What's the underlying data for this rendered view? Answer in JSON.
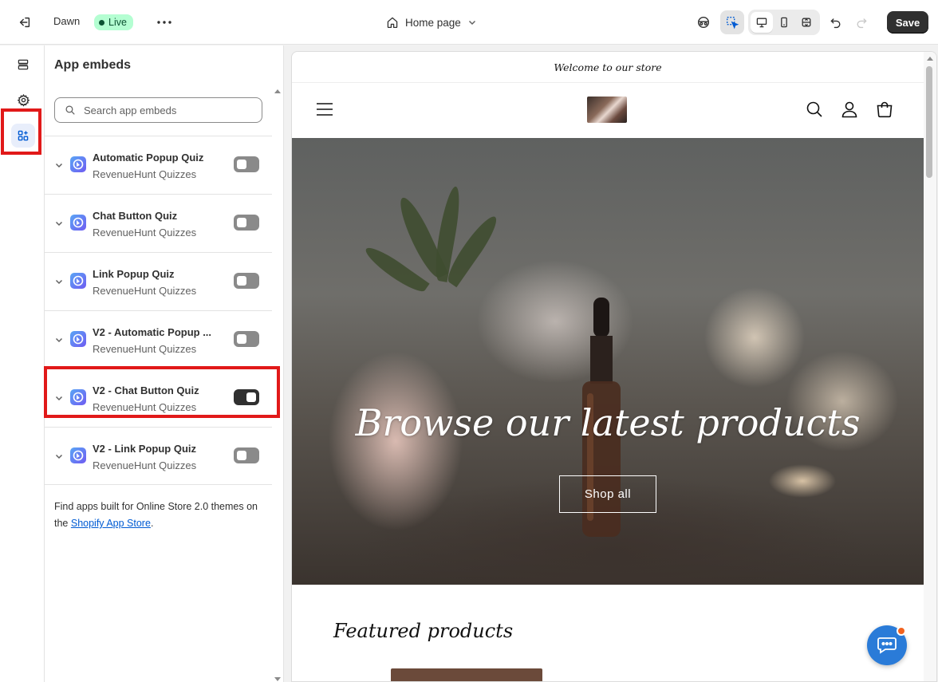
{
  "topbar": {
    "theme_name": "Dawn",
    "status_badge": "Live",
    "page_selector": "Home page",
    "save_label": "Save"
  },
  "panel": {
    "title": "App embeds",
    "search_placeholder": "Search app embeds",
    "items": [
      {
        "name": "Automatic Popup Quiz",
        "vendor": "RevenueHunt Quizzes",
        "enabled": false
      },
      {
        "name": "Chat Button Quiz",
        "vendor": "RevenueHunt Quizzes",
        "enabled": false
      },
      {
        "name": "Link Popup Quiz",
        "vendor": "RevenueHunt Quizzes",
        "enabled": false
      },
      {
        "name": "V2 - Automatic Popup ...",
        "vendor": "RevenueHunt Quizzes",
        "enabled": false
      },
      {
        "name": "V2 - Chat Button Quiz",
        "vendor": "RevenueHunt Quizzes",
        "enabled": true
      },
      {
        "name": "V2 - Link Popup Quiz",
        "vendor": "RevenueHunt Quizzes",
        "enabled": false
      }
    ],
    "footer_text": "Find apps built for Online Store 2.0 themes on the ",
    "footer_link": "Shopify App Store",
    "footer_end": "."
  },
  "preview": {
    "announcement": "Welcome to our store",
    "hero_title": "Browse our latest products",
    "hero_button": "Shop all",
    "featured_title": "Featured products"
  },
  "colors": {
    "accent": "#005bd3",
    "toggle_on": "#303030",
    "toggle_off": "#8a8a8a",
    "highlight": "#e11919",
    "live_badge_bg": "#b4fed2"
  }
}
